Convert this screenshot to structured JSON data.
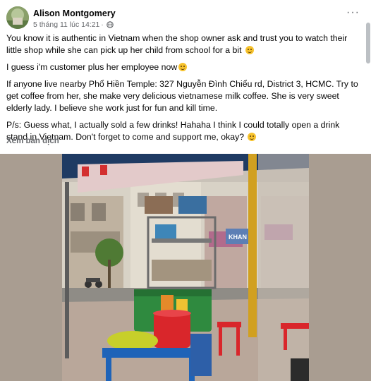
{
  "post": {
    "author": "Alison Montgomery",
    "timestamp": "5 tháng 11 lúc 14:21",
    "separator": "·",
    "more_label": "···",
    "paragraphs": [
      "You know it is authentic in Vietnam when the shop owner ask and trust you to watch their little shop while she can pick up her child from school for a bit",
      "I guess i'm customer plus her employee now",
      "If anyone live nearby Phổ Hiền Temple: 327 Nguyễn Đình Chiểu rd, District 3, HCMC. Try to get coffee from her, she make very delicious vietnamese milk coffee. She is very sweet elderly lady. I believe she work just for fun and kill time.",
      "P/s: Guess what, I actually sold a few drinks! Hahaha I think I could totally open a drink stand in Vietnam. Don't forget to come and support me, okay?"
    ],
    "translate_label": "Xem bản dịch"
  },
  "photo": {
    "store_signs": [
      "KHAN"
    ]
  },
  "colors": {
    "text": "#050505",
    "secondary": "#65676b",
    "cooler": "#2f8a3f",
    "stool_red": "#d9262b",
    "stool_blue": "#1e63b8",
    "basin": "#c7cf2a"
  }
}
